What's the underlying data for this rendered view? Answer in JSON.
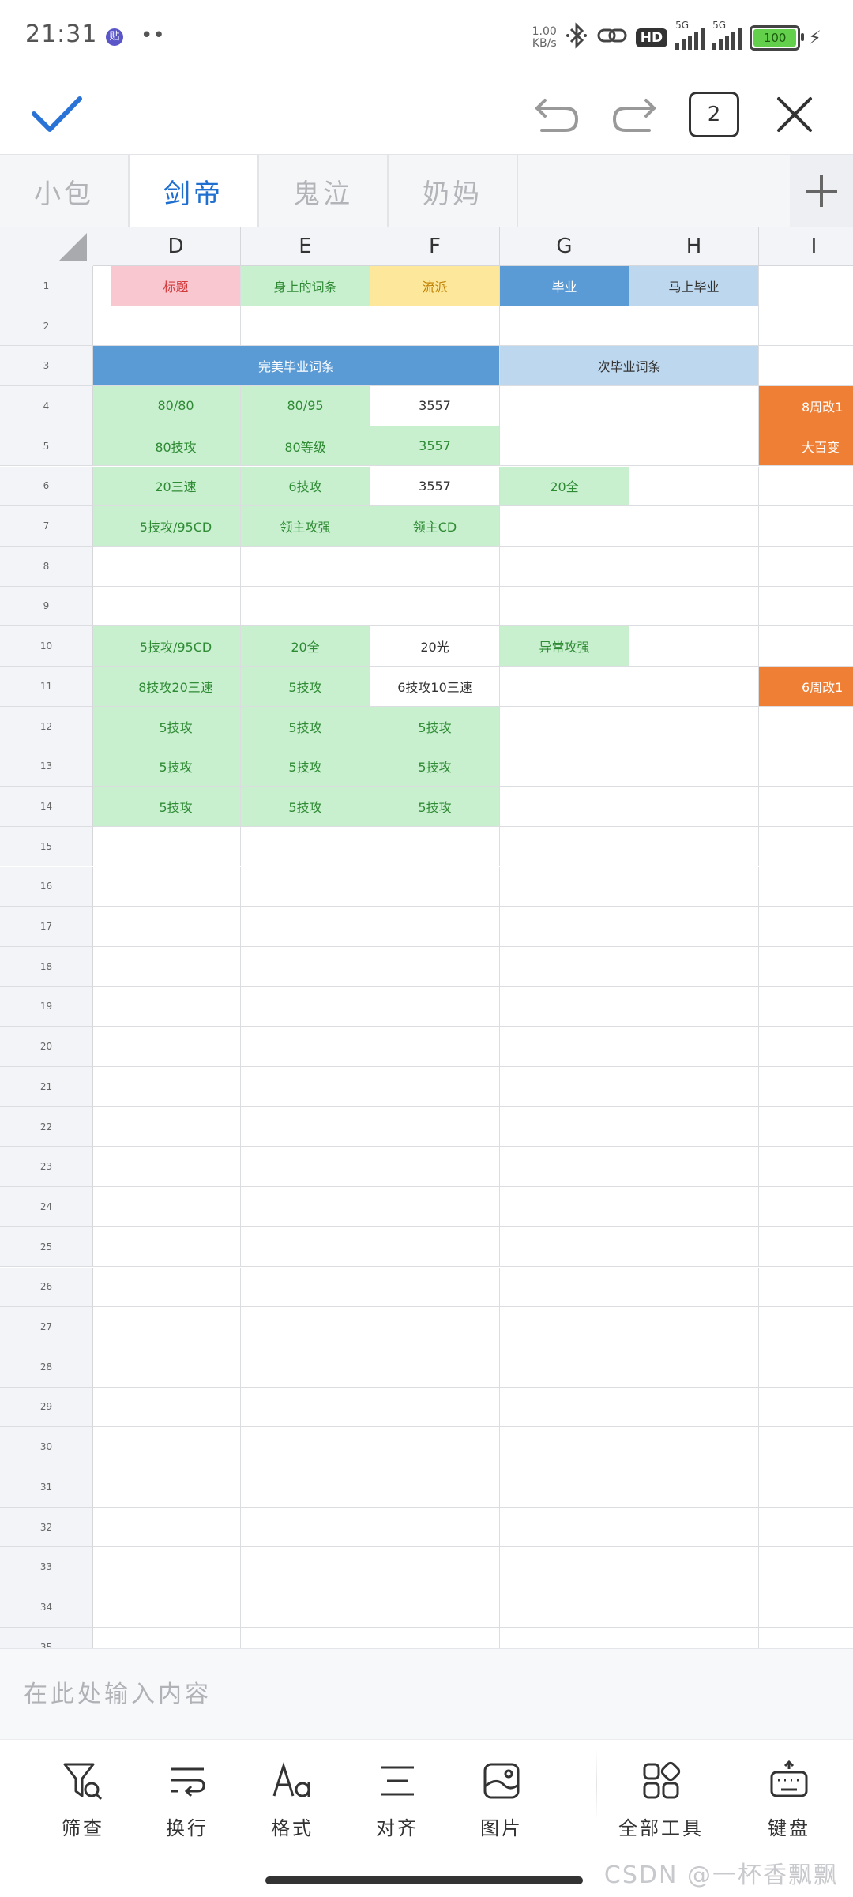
{
  "status_bar": {
    "time": "21:31",
    "app_badge": "贴",
    "dots": "••",
    "net_speed_value": "1.00",
    "net_speed_unit": "KB/s",
    "hd_badge": "HD",
    "signal_1_label": "5G",
    "signal_2_label": "5G",
    "battery": "100",
    "icons": [
      "bluetooth-icon",
      "link-icon",
      "hd-icon",
      "signal-icon",
      "signal-icon",
      "battery-icon",
      "charging-icon"
    ]
  },
  "toolbar": {
    "confirm_icon": "check-icon",
    "undo_icon": "undo-icon",
    "redo_icon": "redo-icon",
    "page_count": "2",
    "close_icon": "close-icon",
    "accent": "#2a73d6"
  },
  "tabs": {
    "items": [
      {
        "label": "小包",
        "active": false
      },
      {
        "label": "剑帝",
        "active": true
      },
      {
        "label": "鬼泣",
        "active": false
      },
      {
        "label": "奶妈",
        "active": false
      }
    ],
    "add_icon": "plus-icon"
  },
  "sheet": {
    "columns": [
      "D",
      "E",
      "F",
      "G",
      "H",
      "I"
    ],
    "rows": [
      "1",
      "2",
      "3",
      "4",
      "5",
      "6",
      "7",
      "8",
      "9",
      "10",
      "11",
      "12",
      "13",
      "14",
      "15",
      "16",
      "17",
      "18",
      "19",
      "20",
      "21",
      "22",
      "23",
      "24",
      "25",
      "26",
      "27",
      "28",
      "29",
      "30",
      "31",
      "32",
      "33",
      "34",
      "35"
    ],
    "colors": {
      "pink": "#f9c7d0",
      "light_green": "#c8f0cf",
      "yellow": "#fce79a",
      "blue": "#5b9bd5",
      "light_blue": "#bdd7ee",
      "orange": "#ee7f35",
      "text_red": "#d23b3b",
      "text_green": "#2f8a34",
      "text_orange": "#c08000",
      "text_white": "#ffffff",
      "text_dark": "#333333"
    },
    "cells": {
      "r1": {
        "D": "标题",
        "E": "身上的词条",
        "F": "流派",
        "G": "毕业",
        "H": "马上毕业"
      },
      "r3": {
        "merged_DF": "完美毕业词条",
        "merged_GH": "次毕业词条"
      },
      "r4": {
        "D": "80/80",
        "E": "80/95",
        "F": "3557",
        "I": "8周改1"
      },
      "r5": {
        "D": "80技攻",
        "E": "80等级",
        "F": "3557",
        "I": "大百变"
      },
      "r6": {
        "D": "20三速",
        "E": "6技攻",
        "F": "3557",
        "G": "20全"
      },
      "r7": {
        "D": "5技攻/95CD",
        "E": "领主攻强",
        "F": "领主CD"
      },
      "r10": {
        "D": "5技攻/95CD",
        "E": "20全",
        "F": "20光",
        "G": "异常攻强"
      },
      "r11": {
        "D": "8技攻20三速",
        "E": "5技攻",
        "F": "6技攻10三速",
        "I": "6周改1"
      },
      "r12": {
        "D": "5技攻",
        "E": "5技攻",
        "F": "5技攻"
      },
      "r13": {
        "D": "5技攻",
        "E": "5技攻",
        "F": "5技攻"
      },
      "r14": {
        "D": "5技攻",
        "E": "5技攻",
        "F": "5技攻"
      }
    }
  },
  "input_bar": {
    "placeholder": "在此处输入内容",
    "value": ""
  },
  "bottom_tools": {
    "items": [
      {
        "label": "筛查",
        "icon": "filter-icon"
      },
      {
        "label": "换行",
        "icon": "wrap-icon"
      },
      {
        "label": "格式",
        "icon": "format-icon"
      },
      {
        "label": "对齐",
        "icon": "align-icon"
      },
      {
        "label": "图片",
        "icon": "image-icon"
      },
      {
        "label": "全部工具",
        "icon": "all-tools-icon"
      },
      {
        "label": "键盘",
        "icon": "keyboard-icon"
      }
    ]
  },
  "watermark": "CSDN @一杯香飘飘"
}
